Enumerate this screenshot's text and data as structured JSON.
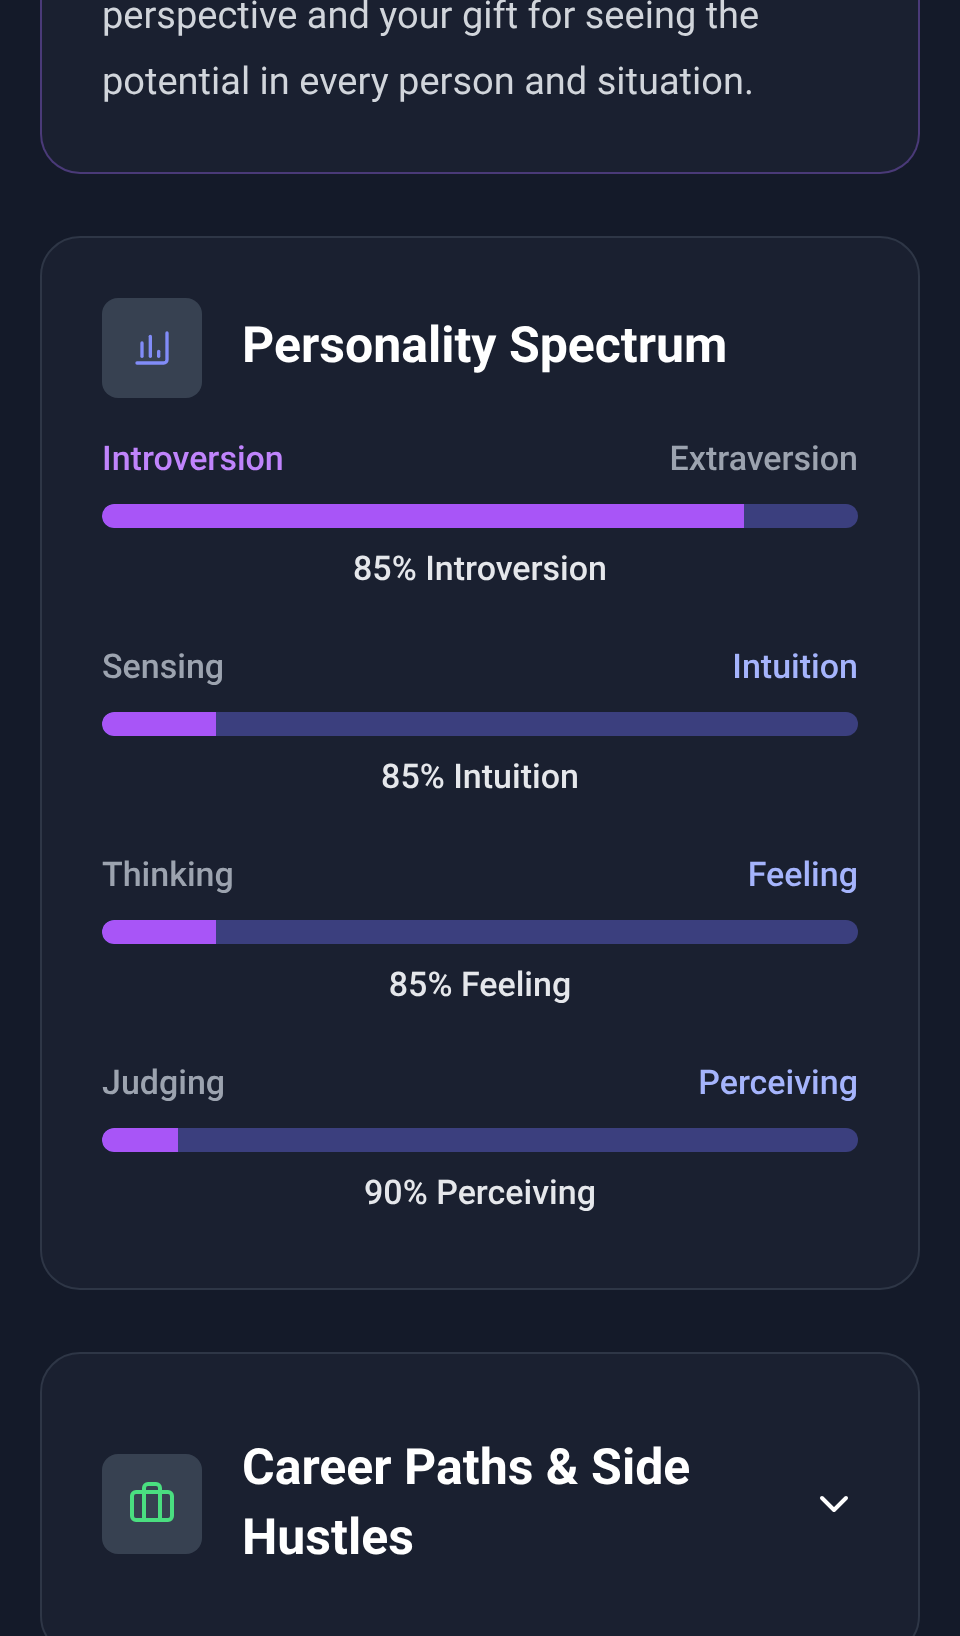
{
  "summary_card": {
    "lines": [
      "perspective and your gift for seeing the",
      "potential in every person and situation."
    ]
  },
  "spectrum_card": {
    "title": "Personality Spectrum",
    "traits": [
      {
        "left": {
          "label": "Introversion",
          "selected": true
        },
        "right": {
          "label": "Extraversion",
          "selected": false
        },
        "level": 0.85,
        "result": "85% Introversion"
      },
      {
        "left": {
          "label": "Sensing",
          "selected": false
        },
        "right": {
          "label": "Intuition",
          "selected": true
        },
        "level": 0.15,
        "result": "85% Intuition"
      },
      {
        "left": {
          "label": "Thinking",
          "selected": false
        },
        "right": {
          "label": "Feeling",
          "selected": true
        },
        "level": 0.15,
        "result": "85% Feeling"
      },
      {
        "left": {
          "label": "Judging",
          "selected": false
        },
        "right": {
          "label": "Perceiving",
          "selected": true
        },
        "level": 0.1,
        "result": "90% Perceiving"
      }
    ]
  },
  "career_card": {
    "title": "Career Paths & Side Hustles",
    "expanded": false
  }
}
